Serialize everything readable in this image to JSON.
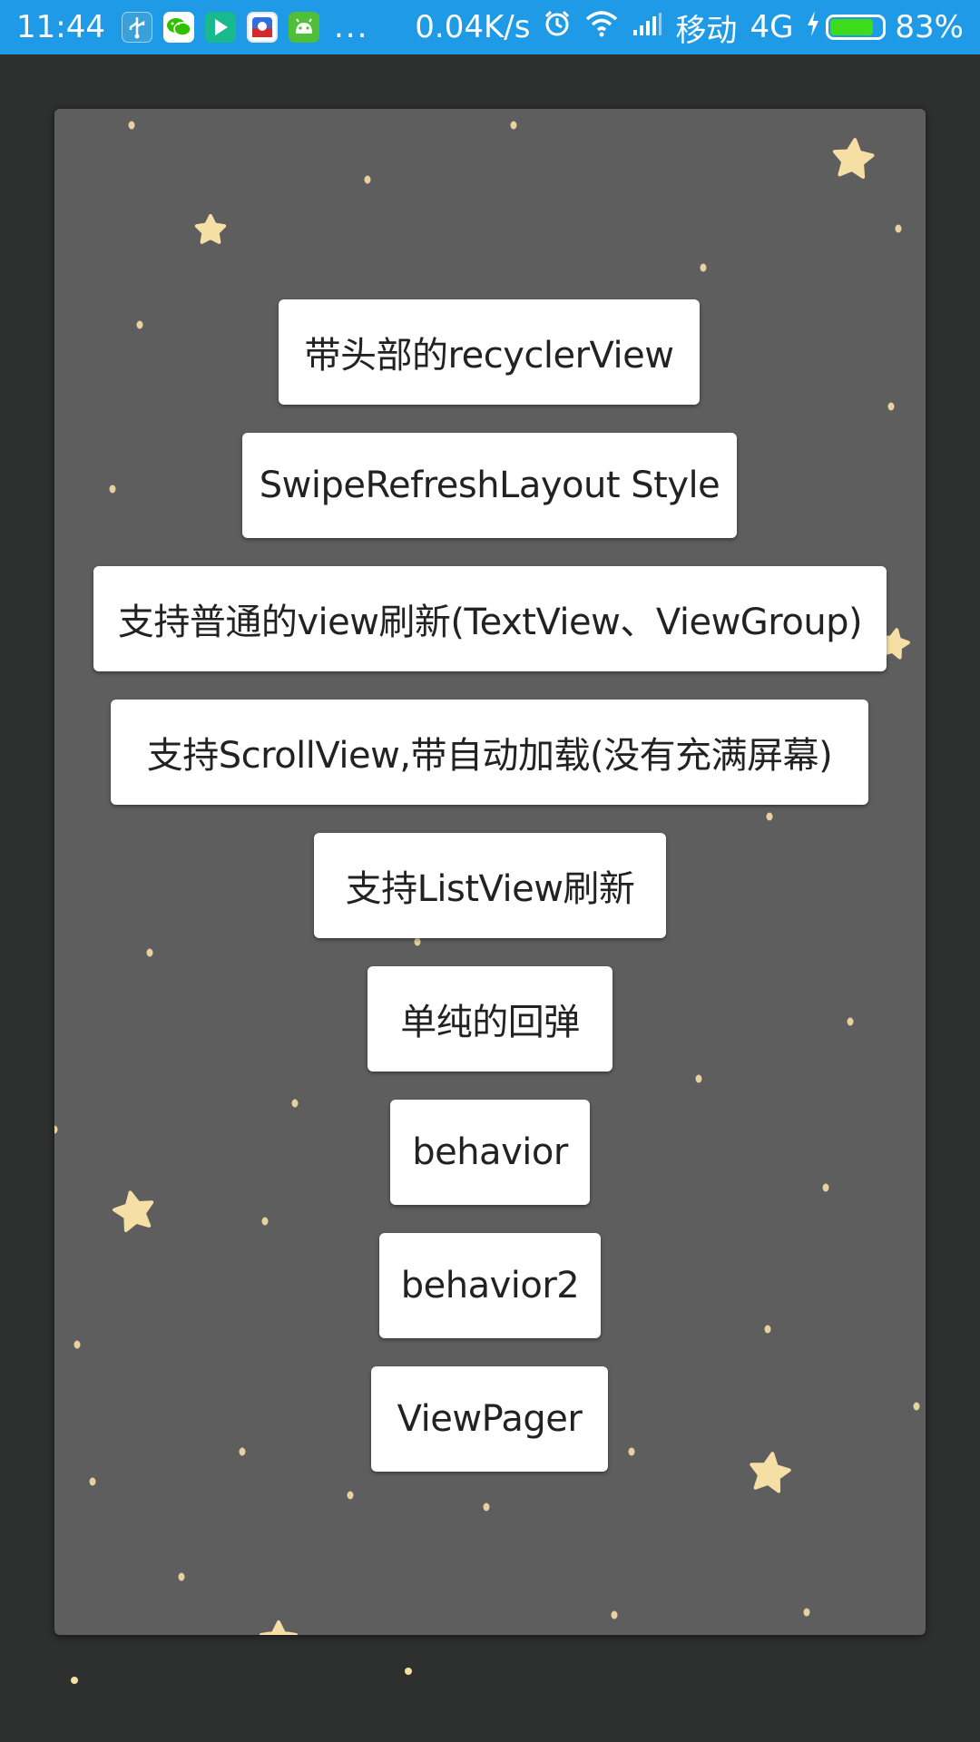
{
  "status_bar": {
    "time": "11:44",
    "notification_icons": [
      "usb-icon",
      "wechat-icon",
      "play-icon",
      "du-icon",
      "android-icon"
    ],
    "more": "...",
    "net_speed": "0.04K/s",
    "carrier": "移动",
    "network": "4G",
    "battery_percent": "83%",
    "battery_level": 0.83,
    "colors": {
      "bar": "#1e9ae7",
      "battery_fill": "#3cdc1c"
    }
  },
  "buttons": [
    {
      "label": "带头部的recyclerView"
    },
    {
      "label": "SwipeRefreshLayout Style"
    },
    {
      "label": "支持普通的view刷新(TextView、ViewGroup)"
    },
    {
      "label": "支持ScrollView,带自动加载(没有充满屏幕)"
    },
    {
      "label": "支持ListView刷新"
    },
    {
      "label": "单纯的回弹"
    },
    {
      "label": "behavior"
    },
    {
      "label": "behavior2"
    },
    {
      "label": "ViewPager"
    }
  ],
  "colors": {
    "page_background": "#2e2f2f",
    "card_background": "#5e5e5e",
    "star": "#f6dfa4",
    "button_background": "#ffffff"
  }
}
